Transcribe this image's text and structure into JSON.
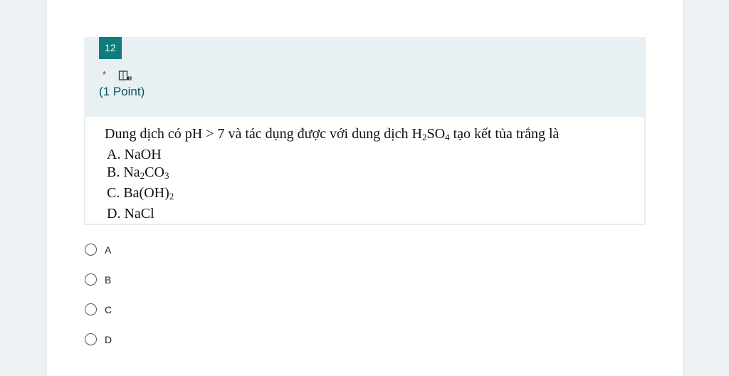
{
  "question": {
    "number": "12",
    "required_mark": "*",
    "points": "(1 Point)",
    "reader_icon": "immersive-reader-icon",
    "body": {
      "stem_parts": [
        "Dung dịch có pH > 7 và tác dụng được với dung dịch H",
        "2",
        "SO",
        "4",
        " tạo kết tủa trắng là"
      ],
      "option_a": "A. NaOH",
      "option_b_parts": [
        "B. Na",
        "2",
        "CO",
        "3"
      ],
      "option_c_parts": [
        "C. Ba(OH)",
        "2"
      ],
      "option_d": "D. NaCl"
    }
  },
  "choices": [
    {
      "label": "A",
      "selected": false
    },
    {
      "label": "B",
      "selected": false
    },
    {
      "label": "C",
      "selected": false
    },
    {
      "label": "D",
      "selected": false
    }
  ],
  "colors": {
    "accent": "#0f7b7a",
    "points_text": "#0b5560",
    "required": "#a4262c",
    "header_bg": "#e8f0f4"
  }
}
